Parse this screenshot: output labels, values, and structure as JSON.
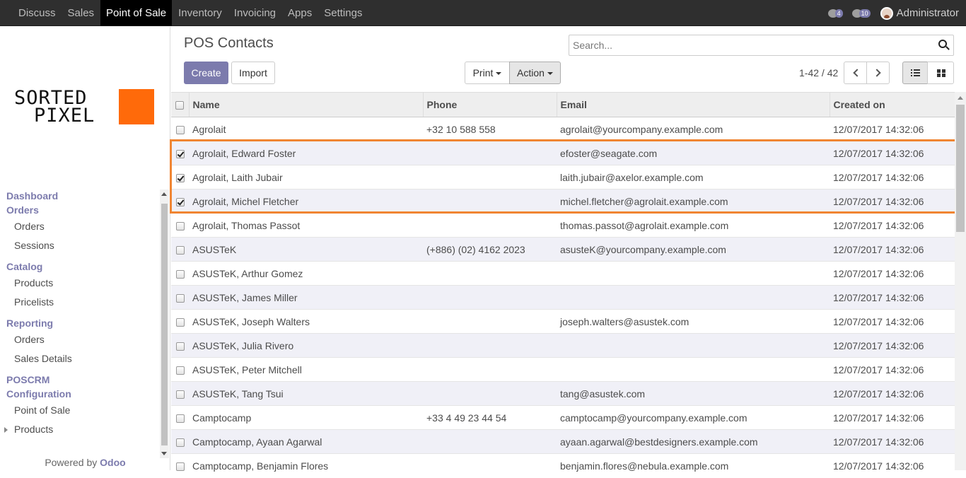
{
  "topbar": {
    "menu": [
      "Discuss",
      "Sales",
      "Point of Sale",
      "Inventory",
      "Invoicing",
      "Apps",
      "Settings"
    ],
    "active": "Point of Sale",
    "activity_count": "4",
    "message_count": "10",
    "user": "Administrator"
  },
  "sidebar": {
    "logo_line1": "SORTED",
    "logo_line2": "PIXEL",
    "logo_color": "#ff6a0a",
    "sections": [
      {
        "type": "sec",
        "label": "Dashboard"
      },
      {
        "type": "sec",
        "label": "Orders"
      },
      {
        "type": "sub",
        "label": "Orders"
      },
      {
        "type": "sub",
        "label": "Sessions"
      },
      {
        "type": "sec",
        "label": "Catalog"
      },
      {
        "type": "sub",
        "label": "Products"
      },
      {
        "type": "sub",
        "label": "Pricelists"
      },
      {
        "type": "sec",
        "label": "Reporting"
      },
      {
        "type": "sub",
        "label": "Orders"
      },
      {
        "type": "sub",
        "label": "Sales Details"
      },
      {
        "type": "sec",
        "label": "POSCRM"
      },
      {
        "type": "sec",
        "label": "Configuration"
      },
      {
        "type": "sub",
        "label": "Point of Sale"
      },
      {
        "type": "sub",
        "label": "Products",
        "expandable": true
      }
    ],
    "powered_by": "Powered by",
    "powered_brand": "Odoo"
  },
  "control": {
    "title": "POS Contacts",
    "search_placeholder": "Search...",
    "create": "Create",
    "import": "Import",
    "print": "Print",
    "action": "Action",
    "pager": "1-42 / 42"
  },
  "table": {
    "headers": [
      "Name",
      "Phone",
      "Email",
      "Created on"
    ],
    "rows": [
      {
        "checked": false,
        "name": "Agrolait",
        "phone": "+32 10 588 558",
        "email": "agrolait@yourcompany.example.com",
        "created": "12/07/2017 14:32:06"
      },
      {
        "checked": true,
        "name": "Agrolait, Edward Foster",
        "phone": "",
        "email": "efoster@seagate.com",
        "created": "12/07/2017 14:32:06"
      },
      {
        "checked": true,
        "name": "Agrolait, Laith Jubair",
        "phone": "",
        "email": "laith.jubair@axelor.example.com",
        "created": "12/07/2017 14:32:06"
      },
      {
        "checked": true,
        "name": "Agrolait, Michel Fletcher",
        "phone": "",
        "email": "michel.fletcher@agrolait.example.com",
        "created": "12/07/2017 14:32:06"
      },
      {
        "checked": false,
        "name": "Agrolait, Thomas Passot",
        "phone": "",
        "email": "thomas.passot@agrolait.example.com",
        "created": "12/07/2017 14:32:06"
      },
      {
        "checked": false,
        "name": "ASUSTeK",
        "phone": "(+886) (02) 4162 2023",
        "email": "asusteK@yourcompany.example.com",
        "created": "12/07/2017 14:32:06"
      },
      {
        "checked": false,
        "name": "ASUSTeK, Arthur Gomez",
        "phone": "",
        "email": "",
        "created": "12/07/2017 14:32:06"
      },
      {
        "checked": false,
        "name": "ASUSTeK, James Miller",
        "phone": "",
        "email": "",
        "created": "12/07/2017 14:32:06"
      },
      {
        "checked": false,
        "name": "ASUSTeK, Joseph Walters",
        "phone": "",
        "email": "joseph.walters@asustek.com",
        "created": "12/07/2017 14:32:06"
      },
      {
        "checked": false,
        "name": "ASUSTeK, Julia Rivero",
        "phone": "",
        "email": "",
        "created": "12/07/2017 14:32:06"
      },
      {
        "checked": false,
        "name": "ASUSTeK, Peter Mitchell",
        "phone": "",
        "email": "",
        "created": "12/07/2017 14:32:06"
      },
      {
        "checked": false,
        "name": "ASUSTeK, Tang Tsui",
        "phone": "",
        "email": "tang@asustek.com",
        "created": "12/07/2017 14:32:06"
      },
      {
        "checked": false,
        "name": "Camptocamp",
        "phone": "+33 4 49 23 44 54",
        "email": "camptocamp@yourcompany.example.com",
        "created": "12/07/2017 14:32:06"
      },
      {
        "checked": false,
        "name": "Camptocamp, Ayaan Agarwal",
        "phone": "",
        "email": "ayaan.agarwal@bestdesigners.example.com",
        "created": "12/07/2017 14:32:06"
      },
      {
        "checked": false,
        "name": "Camptocamp, Benjamin Flores",
        "phone": "",
        "email": "benjamin.flores@nebula.example.com",
        "created": "12/07/2017 14:32:06"
      }
    ]
  },
  "colors": {
    "brand": "#7c7bad",
    "highlight": "#f08532"
  }
}
